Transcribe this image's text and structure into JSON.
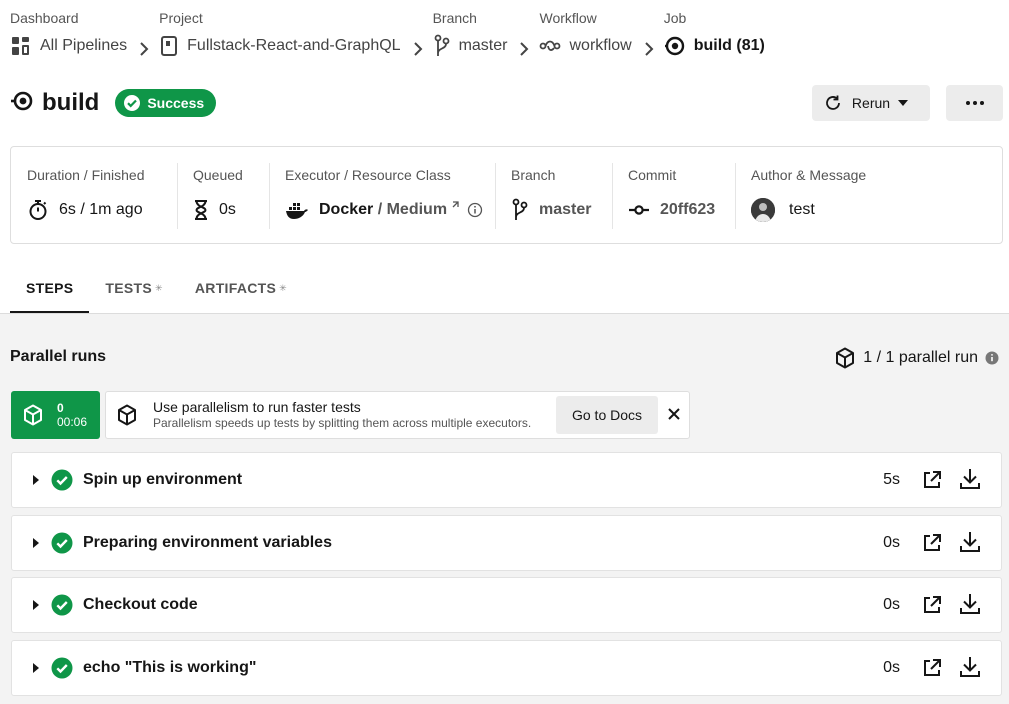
{
  "breadcrumbs": [
    {
      "label": "Dashboard",
      "value": "All Pipelines",
      "icon": "dashboard-icon"
    },
    {
      "label": "Project",
      "value": "Fullstack-React-and-GraphQL",
      "icon": "project-icon"
    },
    {
      "label": "Branch",
      "value": "master",
      "icon": "branch-icon"
    },
    {
      "label": "Workflow",
      "value": "workflow",
      "icon": "workflow-icon"
    },
    {
      "label": "Job",
      "value": "build (81)",
      "icon": "job-icon"
    }
  ],
  "header": {
    "title": "build",
    "status": "Success",
    "rerun_label": "Rerun",
    "more_label": "•••"
  },
  "info": {
    "duration": {
      "label": "Duration / Finished",
      "value": "6s / 1m ago"
    },
    "queued": {
      "label": "Queued",
      "value": "0s"
    },
    "executor": {
      "label": "Executor / Resource Class",
      "name": "Docker",
      "sep": " / ",
      "resource": "Medium"
    },
    "branch": {
      "label": "Branch",
      "value": "master"
    },
    "commit": {
      "label": "Commit",
      "value": "20ff623"
    },
    "author": {
      "label": "Author & Message",
      "value": "test"
    }
  },
  "tabs": [
    {
      "label": "STEPS",
      "active": true
    },
    {
      "label": "TESTS",
      "active": false
    },
    {
      "label": "ARTIFACTS",
      "active": false
    }
  ],
  "parallel": {
    "title": "Parallel runs",
    "count": "1 / 1 parallel run",
    "run_index": "0",
    "run_time": "00:06"
  },
  "promo": {
    "title": "Use parallelism to run faster tests",
    "subtitle": "Parallelism speeds up tests by splitting them across multiple executors.",
    "docs_label": "Go to Docs"
  },
  "steps": [
    {
      "name": "Spin up environment",
      "duration": "5s"
    },
    {
      "name": "Preparing environment variables",
      "duration": "0s"
    },
    {
      "name": "Checkout code",
      "duration": "0s"
    },
    {
      "name": "echo \"This is working\"",
      "duration": "0s"
    }
  ],
  "colors": {
    "success": "#0f9648",
    "background_lower": "#f3f3f3",
    "button_bg": "#ececec"
  }
}
